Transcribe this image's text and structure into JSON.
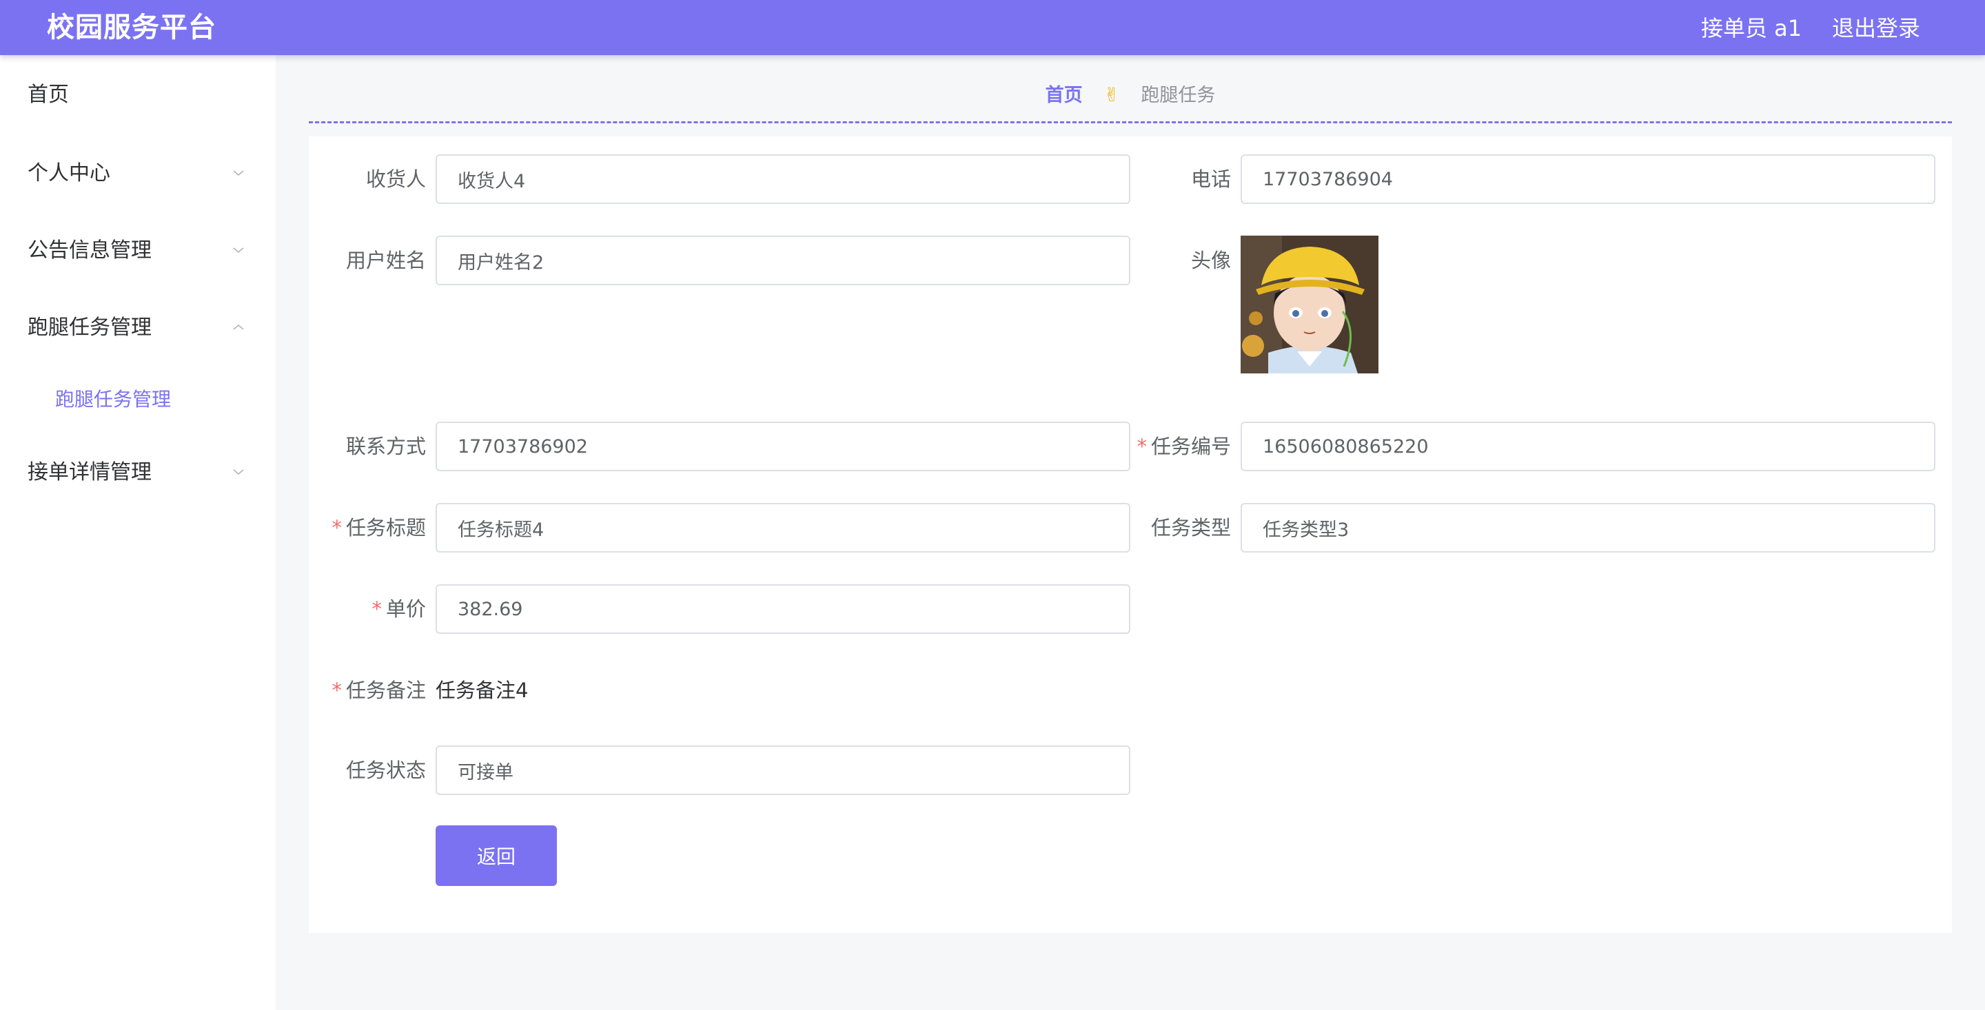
{
  "header": {
    "title": "校园服务平台",
    "user": "接单员 a1",
    "logout": "退出登录"
  },
  "sidebar": {
    "items": [
      {
        "label": "首页"
      },
      {
        "label": "个人中心"
      },
      {
        "label": "公告信息管理"
      },
      {
        "label": "跑腿任务管理",
        "expanded": true
      },
      {
        "label": "接单详情管理"
      }
    ],
    "submenu": {
      "label": "跑腿任务管理",
      "active": true
    }
  },
  "breadcrumb": {
    "home": "首页",
    "separator": "✌",
    "current": "跑腿任务"
  },
  "form": {
    "receiver": {
      "label": "收货人",
      "value": "收货人4"
    },
    "phone": {
      "label": "电话",
      "value": "17703786904"
    },
    "username": {
      "label": "用户姓名",
      "value": "用户姓名2"
    },
    "avatar": {
      "label": "头像"
    },
    "contact": {
      "label": "联系方式",
      "value": "17703786902"
    },
    "task_no": {
      "label": "任务编号",
      "value": "16506080865220",
      "required": "*"
    },
    "task_title": {
      "label": "任务标题",
      "value": "任务标题4",
      "required": "*"
    },
    "task_type": {
      "label": "任务类型",
      "value": "任务类型3"
    },
    "price": {
      "label": "单价",
      "value": "382.69",
      "required": "*"
    },
    "remark": {
      "label": "任务备注",
      "value": "任务备注4",
      "required": "*"
    },
    "status": {
      "label": "任务状态",
      "value": "可接单"
    },
    "back_button": "返回"
  },
  "colors": {
    "primary": "#7b72f2",
    "required": "#f56c6c",
    "background": "#f6f7f9"
  }
}
